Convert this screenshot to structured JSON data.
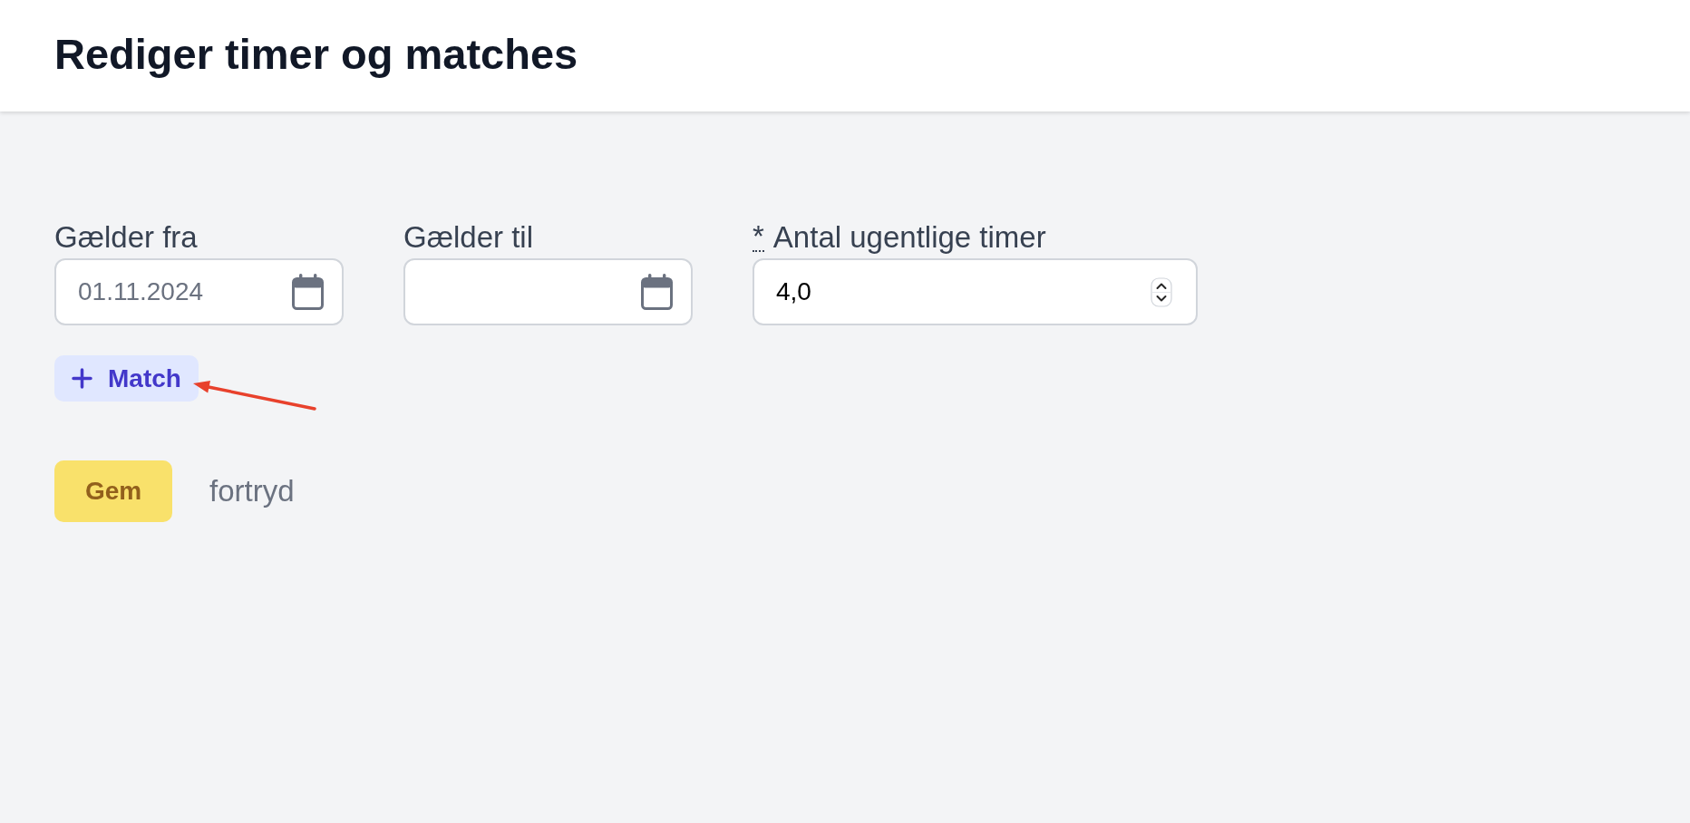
{
  "header": {
    "title": "Rediger timer og matches"
  },
  "fields": [
    {
      "kind": "date",
      "label": "Gælder fra",
      "value": "01.11.2024"
    },
    {
      "kind": "date",
      "label": "Gælder til"
    },
    {
      "kind": "number",
      "required_mark": "*",
      "label": "Antal ugentlige timer",
      "value": "4,0"
    }
  ],
  "add_match_button": {
    "label": "Match"
  },
  "actions": [
    {
      "kind": "primary",
      "label": "Gem"
    },
    {
      "kind": "link",
      "label": "fortryd"
    }
  ]
}
